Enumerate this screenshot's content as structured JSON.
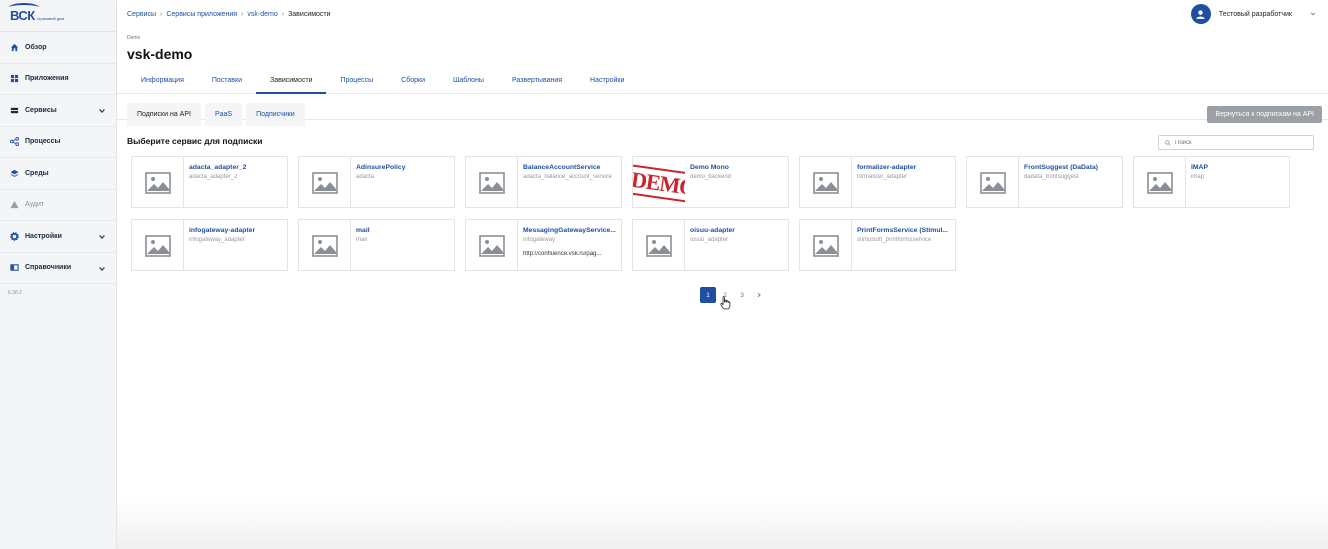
{
  "sidebar": {
    "logo_text": "ВСК",
    "logo_sub": "страховой дом",
    "items": [
      {
        "label": "Обзор",
        "icon": "home-icon"
      },
      {
        "label": "Приложения",
        "icon": "apps-grid-icon"
      },
      {
        "label": "Сервисы",
        "icon": "services-icon"
      },
      {
        "label": "Процессы",
        "icon": "process-icon"
      },
      {
        "label": "Среды",
        "icon": "layers-icon"
      },
      {
        "label": "Аудит",
        "icon": "warning-icon"
      },
      {
        "label": "Настройки",
        "icon": "gear-icon"
      },
      {
        "label": "Справочники",
        "icon": "book-icon"
      }
    ],
    "version": "6.38.2"
  },
  "header": {
    "breadcrumbs": [
      "Сервисы",
      "Сервисы приложения",
      "vsk-demo",
      "Зависимости"
    ],
    "user_name": "Тестовый разработчик",
    "small_label": "Demo",
    "title": "vsk-demo",
    "tabs": [
      "Информация",
      "Поставки",
      "Зависимости",
      "Процессы",
      "Сборки",
      "Шаблоны",
      "Развертывания",
      "Настройки"
    ],
    "active_tab": "Зависимости"
  },
  "content": {
    "subtabs": [
      "Подписки на API",
      "PaaS",
      "Подписчики"
    ],
    "active_subtab": "Подписки на API",
    "back_button": "Вернуться к подпискам на API",
    "section_title": "Выберите сервис для подписки",
    "search_placeholder": "Поиск",
    "cards": [
      {
        "name": "adacta_adapter_2",
        "code": "adacta_adapter_2",
        "extra": ""
      },
      {
        "name": "AdinsurePolicy",
        "code": "adacta",
        "extra": ""
      },
      {
        "name": "BalanceAccountService",
        "code": "adacta_balance_account_service",
        "extra": ""
      },
      {
        "name": "Demo Mono",
        "code": "demo_backend",
        "extra": "",
        "stamp": "DEMO"
      },
      {
        "name": "formalizer-adapter",
        "code": "formalizer_adapter",
        "extra": ""
      },
      {
        "name": "FrontSuggest (DaData)",
        "code": "dadata_frontsuggest",
        "extra": ""
      },
      {
        "name": "IMAP",
        "code": "imap",
        "extra": ""
      },
      {
        "name": "infogateway-adapter",
        "code": "infogateway_adapter",
        "extra": ""
      },
      {
        "name": "mail",
        "code": "mail",
        "extra": ""
      },
      {
        "name": "MessagingGatewayService...",
        "code": "infogateway",
        "extra": "http://confluence.vsk.ru/pag..."
      },
      {
        "name": "oisuu-adapter",
        "code": "oisuu_adapter",
        "extra": ""
      },
      {
        "name": "PrintFormsService (Stimul...",
        "code": "stimulsoft_printformsservice",
        "extra": ""
      }
    ],
    "pagination": {
      "pages": [
        "1",
        "2",
        "3"
      ],
      "current": "1"
    }
  },
  "colors": {
    "accent": "#1f4fa3",
    "sidebar_bg": "#f4f5f7",
    "button_gray": "#9aa0a6"
  }
}
